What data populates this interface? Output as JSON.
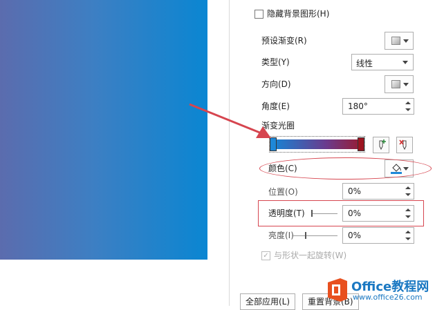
{
  "panel": {
    "hide_background": "隐藏背景图形(H)",
    "preset_gradient": "预设渐变(R)",
    "type": "类型(Y)",
    "type_value": "线性",
    "direction": "方向(D)",
    "angle": "角度(E)",
    "angle_value": "180°",
    "gradient_stops": "渐变光圈",
    "color": "颜色(C)",
    "position": "位置(O)",
    "position_value": "0%",
    "transparency": "透明度(T)",
    "transparency_value": "0%",
    "brightness": "亮度(I)",
    "brightness_value": "0%",
    "rotate_with_shape": "与形状一起旋转(W)",
    "apply_all": "全部应用(L)",
    "reset_background": "重置背景(B)"
  },
  "watermark": {
    "brand": "Office教程网",
    "url": "www.office26.com"
  },
  "colors": {
    "accent_blue": "#0a86d2",
    "stop_red": "#9c1420",
    "annotation_red": "#d6454f",
    "logo_orange": "#e8501f"
  }
}
